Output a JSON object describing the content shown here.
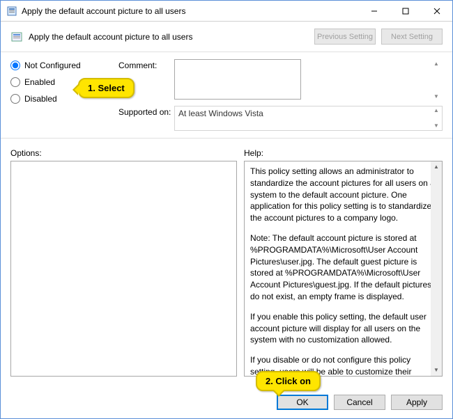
{
  "titlebar": {
    "title": "Apply the default account picture to all users"
  },
  "header": {
    "title": "Apply the default account picture to all users",
    "prev_label": "Previous Setting",
    "next_label": "Next Setting"
  },
  "radios": {
    "not_configured": "Not Configured",
    "enabled": "Enabled",
    "disabled": "Disabled",
    "selected": "not_configured"
  },
  "fields": {
    "comment_label": "Comment:",
    "comment_value": "",
    "supported_label": "Supported on:",
    "supported_value": "At least Windows Vista"
  },
  "panels": {
    "options_label": "Options:",
    "help_label": "Help:"
  },
  "help": {
    "p1": "This policy setting allows an administrator to standardize the account pictures for all users on a system to the default account picture. One application for this policy setting is to standardize the account pictures to a company logo.",
    "p2": "Note: The default account picture is stored at %PROGRAMDATA%\\Microsoft\\User Account Pictures\\user.jpg. The default guest picture is stored at %PROGRAMDATA%\\Microsoft\\User Account Pictures\\guest.jpg. If the default pictures do not exist, an empty frame is displayed.",
    "p3": "If you enable this policy setting, the default user account picture will display for all users on the system with no customization allowed.",
    "p4": "If you disable or do not configure this policy setting, users will be able to customize their account pictures."
  },
  "footer": {
    "ok": "OK",
    "cancel": "Cancel",
    "apply": "Apply"
  },
  "callouts": {
    "c1": "1. Select",
    "c2": "2. Click on"
  }
}
